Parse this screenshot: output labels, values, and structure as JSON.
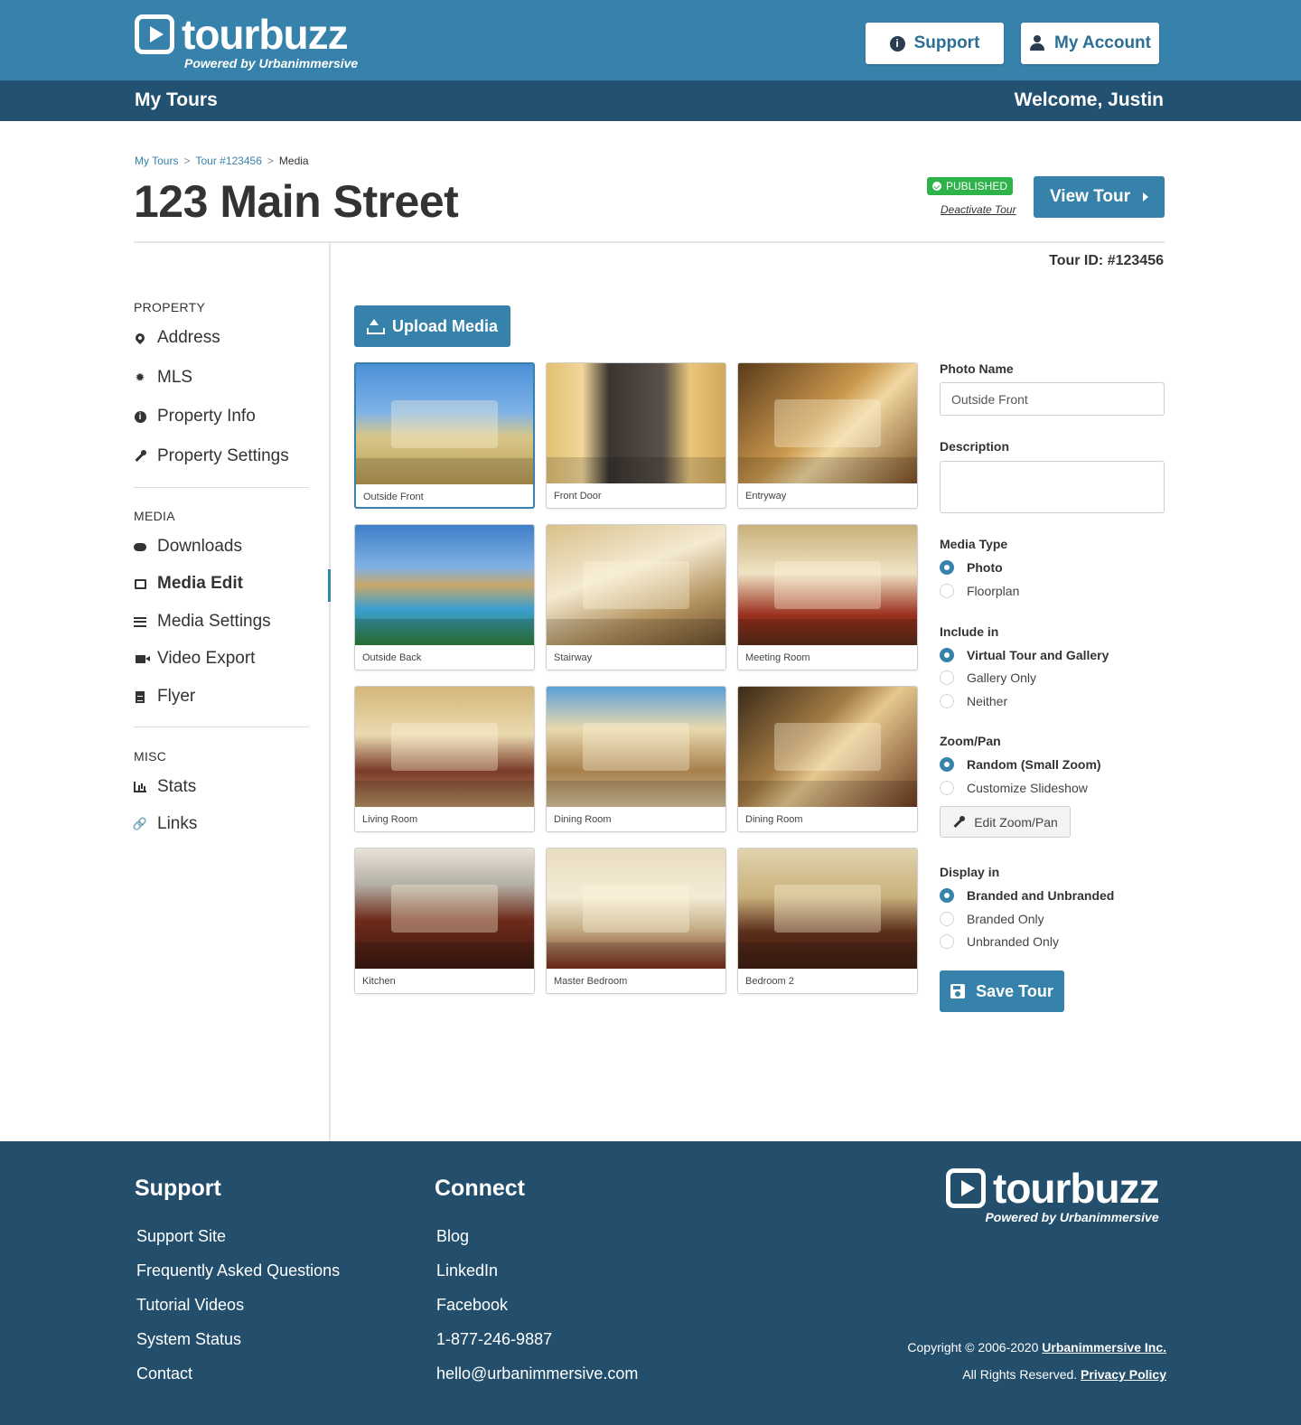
{
  "header": {
    "logo_text": "tourbuzz",
    "logo_sub": "Powered by Urbanimmersive",
    "support_label": "Support",
    "account_label": "My Account",
    "nav_title": "My Tours",
    "welcome": "Welcome, Justin"
  },
  "breadcrumb": [
    "My Tours",
    "Tour #123456",
    "Media"
  ],
  "breadcrumb_sep": ">",
  "page": {
    "title": "123 Main Street",
    "status_badge": "PUBLISHED",
    "deactivate_label": "Deactivate Tour",
    "view_tour_label": "View Tour",
    "tour_id": "Tour ID: #123456"
  },
  "sidebar": {
    "sections": [
      {
        "label": "PROPERTY",
        "items": [
          {
            "label": "Address",
            "icon": "map-pin-icon"
          },
          {
            "label": "MLS",
            "icon": "gear-icon"
          },
          {
            "label": "Property Info",
            "icon": "info-icon"
          },
          {
            "label": "Property Settings",
            "icon": "wrench-icon"
          }
        ]
      },
      {
        "label": "MEDIA",
        "items": [
          {
            "label": "Downloads",
            "icon": "cloud-download-icon"
          },
          {
            "label": "Media Edit",
            "icon": "image-icon",
            "active": true
          },
          {
            "label": "Media Settings",
            "icon": "sliders-icon"
          },
          {
            "label": "Video Export",
            "icon": "video-camera-icon"
          },
          {
            "label": "Flyer",
            "icon": "document-icon"
          }
        ]
      },
      {
        "label": "MISC",
        "items": [
          {
            "label": "Stats",
            "icon": "bar-chart-icon"
          },
          {
            "label": "Links",
            "icon": "link-icon"
          }
        ]
      }
    ]
  },
  "media": {
    "upload_label": "Upload Media",
    "photos": [
      {
        "label": "Outside Front",
        "selected": true
      },
      {
        "label": "Front Door"
      },
      {
        "label": "Entryway"
      },
      {
        "label": "Outside Back"
      },
      {
        "label": "Stairway"
      },
      {
        "label": "Meeting Room"
      },
      {
        "label": "Living Room"
      },
      {
        "label": "Dining Room"
      },
      {
        "label": "Dining Room"
      },
      {
        "label": "Kitchen"
      },
      {
        "label": "Master Bedroom"
      },
      {
        "label": "Bedroom 2"
      }
    ]
  },
  "form": {
    "photo_name_label": "Photo Name",
    "photo_name_value": "Outside Front",
    "description_label": "Description",
    "description_value": "",
    "media_type_label": "Media Type",
    "media_type_options": [
      "Photo",
      "Floorplan"
    ],
    "media_type_selected": "Photo",
    "include_label": "Include in",
    "include_options": [
      "Virtual Tour and Gallery",
      "Gallery Only",
      "Neither"
    ],
    "include_selected": "Virtual Tour and Gallery",
    "zoom_label": "Zoom/Pan",
    "zoom_options": [
      "Random (Small Zoom)",
      "Customize Slideshow"
    ],
    "zoom_selected": "Random (Small Zoom)",
    "edit_zoom_label": "Edit Zoom/Pan",
    "display_label": "Display in",
    "display_options": [
      "Branded and Unbranded",
      "Branded Only",
      "Unbranded Only"
    ],
    "display_selected": "Branded and Unbranded",
    "save_label": "Save Tour"
  },
  "footer": {
    "support_title": "Support",
    "support_links": [
      "Support Site",
      "Frequently Asked Questions",
      "Tutorial Videos",
      "System Status",
      "Contact"
    ],
    "connect_title": "Connect",
    "connect_links": [
      "Blog",
      "LinkedIn",
      "Facebook",
      "1-877-246-9887",
      "hello@urbanimmersive.com"
    ],
    "logo_text": "tourbuzz",
    "logo_sub": "Powered by Urbanimmersive",
    "copyright_prefix": "Copyright © 2006-2020",
    "copyright_company": "Urbanimmersive Inc.",
    "rights_text": "All Rights Reserved.",
    "privacy_label": "Privacy Policy"
  },
  "colors": {
    "header_blue": "#3682ab",
    "subbar_navy": "#225171",
    "footer_navy": "#234f6c",
    "published_green": "#2eb34a"
  }
}
